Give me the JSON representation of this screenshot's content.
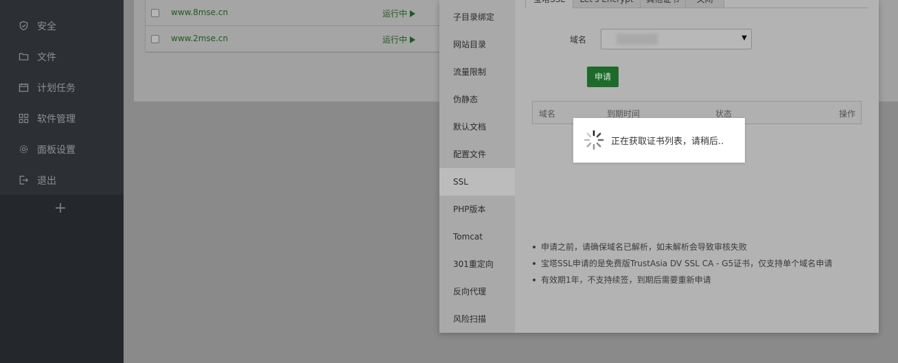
{
  "sidebar": {
    "items": [
      {
        "label": "安全",
        "icon": "shield-icon"
      },
      {
        "label": "文件",
        "icon": "folder-icon"
      },
      {
        "label": "计划任务",
        "icon": "calendar-icon"
      },
      {
        "label": "软件管理",
        "icon": "grid-icon"
      },
      {
        "label": "面板设置",
        "icon": "gear-icon"
      },
      {
        "label": "退出",
        "icon": "logout-icon"
      }
    ],
    "add_label": "+"
  },
  "sites": {
    "rows": [
      {
        "name": "www.8mse.cn",
        "status": "运行中"
      },
      {
        "name": "www.2mse.cn",
        "status": "运行中"
      }
    ]
  },
  "dialog": {
    "nav": [
      "子目录绑定",
      "网站目录",
      "流量限制",
      "伪静态",
      "默认文档",
      "配置文件",
      "SSL",
      "PHP版本",
      "Tomcat",
      "301重定向",
      "反向代理",
      "风险扫描"
    ],
    "active_nav": "SSL",
    "tabs": [
      "宝塔SSL",
      "Let's Encrypt",
      "其他证书",
      "关闭"
    ],
    "domain_label": "域名",
    "apply_label": "申请",
    "table_headers": [
      "域名",
      "到期时间",
      "状态",
      "操作"
    ],
    "tips": [
      "申请之前，请确保域名已解析，如未解析会导致审核失败",
      "宝塔SSL申请的是免费版TrustAsia DV SSL CA - G5证书，仅支持单个域名申请",
      "有效期1年，不支持续签，到期后需要重新申请"
    ]
  },
  "loading": {
    "text": "正在获取证书列表，请稍后.."
  },
  "colors": {
    "sidebar_bg": "#2c2f34",
    "accent_green": "#20a53a",
    "overlay": "#8a8a8a"
  }
}
